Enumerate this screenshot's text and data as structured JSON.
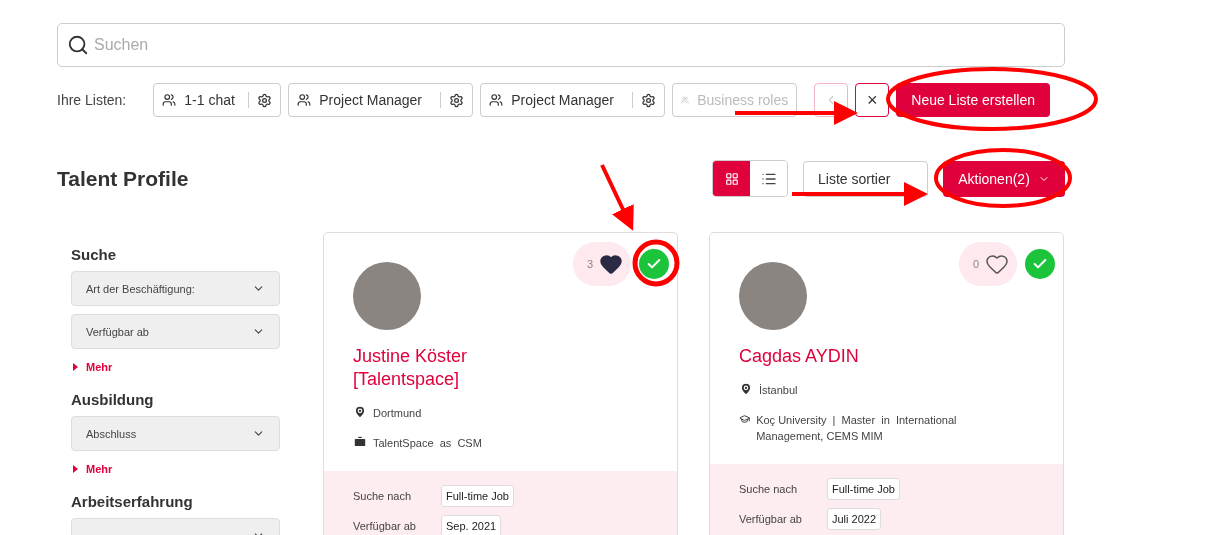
{
  "search": {
    "placeholder": "Suchen"
  },
  "lists": {
    "label": "Ihre Listen:",
    "items": [
      {
        "label": "1-1 chat",
        "faded": false
      },
      {
        "label": "Project Manager",
        "faded": false
      },
      {
        "label": "Project Manager",
        "faded": false
      },
      {
        "label": "Business roles",
        "faded": true
      }
    ],
    "close": "×",
    "create": "Neue Liste erstellen"
  },
  "title": "Talent Profile",
  "view_toggle": [
    {
      "kind": "grid",
      "selected": true
    },
    {
      "kind": "list",
      "selected": false
    }
  ],
  "sort_button": "Liste sortier",
  "actions_button": "Aktionen(2)",
  "filters": [
    {
      "title": "Suche",
      "dropdowns": [
        {
          "kind": "select",
          "label": "Art der Beschäftigung:"
        },
        {
          "kind": "select",
          "label": "Verfügbar ab"
        }
      ],
      "more": "Mehr"
    },
    {
      "title": "Ausbildung",
      "dropdowns": [
        {
          "kind": "select",
          "label": "Abschluss"
        }
      ],
      "more": "Mehr"
    },
    {
      "title": "Arbeitserfahrung",
      "dropdowns": [
        {
          "kind": "select"
        }
      ]
    }
  ],
  "cards": [
    {
      "name": "Justine Köster [Talentspace]",
      "likes": "3",
      "liked": true,
      "selected": true,
      "details": [
        {
          "kind": "location",
          "text": "Dortmund"
        },
        {
          "kind": "work",
          "text": "TalentSpace  as  CSM"
        }
      ],
      "fields": [
        {
          "label": "Suche nach",
          "value": "Full-time Job"
        },
        {
          "label": "Verfügbar ab",
          "value": "Sep. 2021"
        }
      ]
    },
    {
      "name": "Cagdas AYDIN",
      "likes": "0",
      "liked": false,
      "selected": true,
      "details": [
        {
          "kind": "location",
          "text": "İstanbul"
        },
        {
          "kind": "education",
          "text": "Koç University  |  Master  in  International Management, CEMS MIM"
        }
      ],
      "fields": [
        {
          "label": "Suche nach",
          "value": "Full-time Job"
        },
        {
          "label": "Verfügbar ab",
          "value": "Juli 2022"
        }
      ]
    }
  ]
}
